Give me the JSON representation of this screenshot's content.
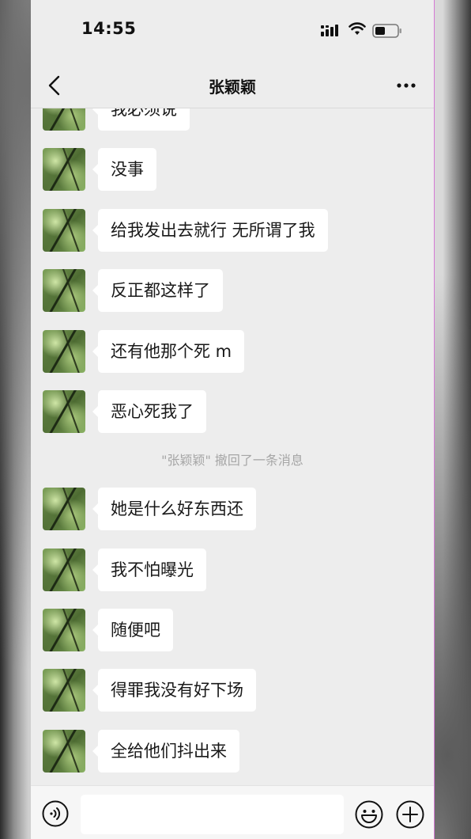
{
  "status_bar": {
    "time": "14:55",
    "icons": [
      "signal-icon",
      "wifi-icon",
      "battery-icon"
    ]
  },
  "nav": {
    "back_icon": "chevron-left-icon",
    "title": "张颖颖",
    "more_icon": "more-dots-icon"
  },
  "messages": [
    {
      "text": "我必须说"
    },
    {
      "text": "没事"
    },
    {
      "text": "给我发出去就行 无所谓了我"
    },
    {
      "text": "反正都这样了"
    },
    {
      "text": "还有他那个死 m"
    },
    {
      "text": "恶心死我了"
    },
    {
      "system": "\"张颖颖\" 撤回了一条消息"
    },
    {
      "text": "她是什么好东西还"
    },
    {
      "text": "我不怕曝光"
    },
    {
      "text": "随便吧"
    },
    {
      "text": "得罪我没有好下场"
    },
    {
      "text": "全给他们抖出来"
    }
  ],
  "input_bar": {
    "voice_icon": "voice-icon",
    "input_value": "",
    "emoji_icon": "emoji-icon",
    "plus_icon": "plus-icon"
  },
  "colors": {
    "chat_background": "#ededed",
    "bubble": "#ffffff",
    "system_text": "#a6a6a6",
    "input_bar": "#f6f6f6"
  }
}
